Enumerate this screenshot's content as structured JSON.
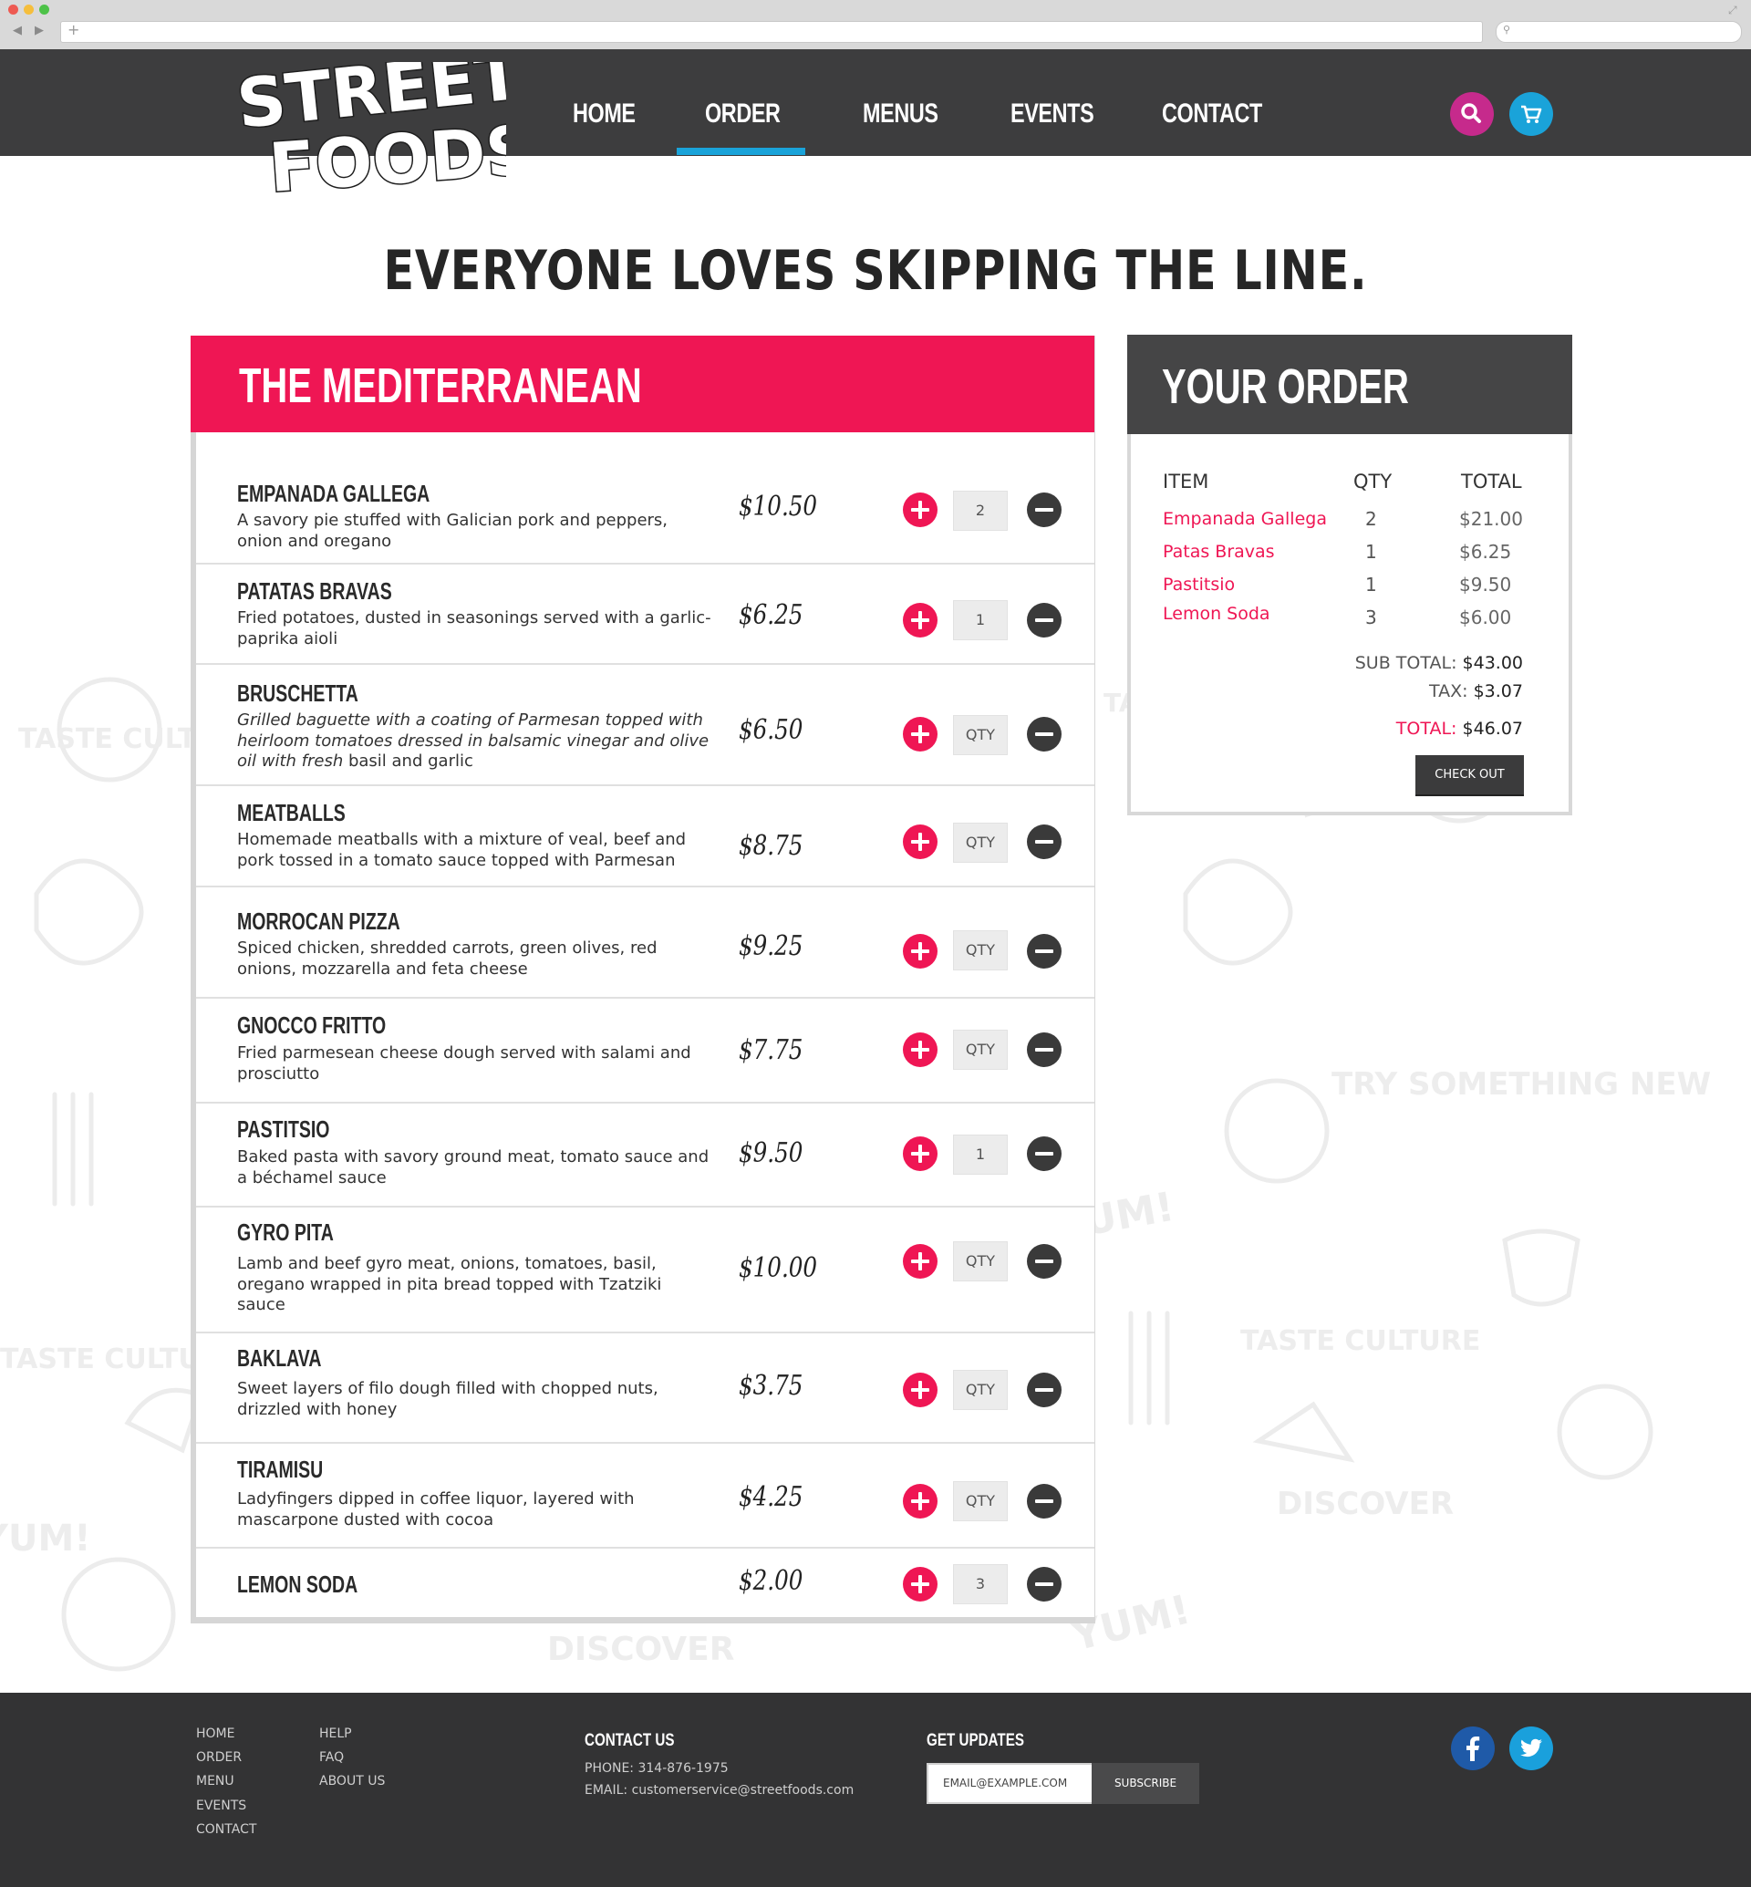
{
  "colors": {
    "header_bg": "#3d3d3e",
    "accent_pink": "#ef1654",
    "accent_blue": "#1aa3d9",
    "search_button": "#c62a8c",
    "cart_button": "#1aa3d9",
    "dark_button": "#3a3a3a",
    "footer_bg": "#333334",
    "facebook": "#1f5aa8",
    "twitter": "#1aa0dc"
  },
  "header": {
    "logo_text": "STREET FOODS",
    "nav": [
      {
        "label": "HOME",
        "active": false
      },
      {
        "label": "ORDER",
        "active": true
      },
      {
        "label": "MENUS",
        "active": false
      },
      {
        "label": "EVENTS",
        "active": false
      },
      {
        "label": "CONTACT",
        "active": false
      }
    ],
    "icons": [
      "search-icon",
      "cart-icon"
    ]
  },
  "tagline": "EVERYONE LOVES SKIPPING THE LINE.",
  "menu": {
    "title": "THE MEDITERRANEAN",
    "items": [
      {
        "name": "EMPANADA GALLEGA",
        "desc": "A savory pie stuffed with Galician pork and peppers, onion and oregano",
        "price": "$10.50",
        "qty": "2"
      },
      {
        "name": "PATATAS BRAVAS",
        "desc": "Fried potatoes, dusted in seasonings served with a garlic-paprika aioli",
        "price": "$6.25",
        "qty": "1"
      },
      {
        "name": "BRUSCHETTA",
        "desc_italic": "Grilled baguette with a coating of Parmesan topped with heirloom tomatoes dressed in balsamic vinegar and olive oil with fresh",
        "desc_rest": " basil and garlic",
        "price": "$6.50",
        "qty_placeholder": "QTY"
      },
      {
        "name": "MEATBALLS",
        "desc": "Homemade meatballs with a mixture of veal, beef and pork tossed in a tomato sauce topped with Parmesan",
        "price": "$8.75",
        "qty_placeholder": "QTY"
      },
      {
        "name": "MORROCAN PIZZA",
        "desc": "Spiced chicken, shredded carrots, green olives, red onions, mozzarella and feta cheese",
        "price": "$9.25",
        "qty_placeholder": "QTY"
      },
      {
        "name": "GNOCCO FRITTO",
        "desc": "Fried parmesean cheese dough served with salami and prosciutto",
        "price": "$7.75",
        "qty_placeholder": "QTY"
      },
      {
        "name": "PASTITSIO",
        "desc": "Baked pasta with savory ground meat, tomato sauce and a béchamel sauce",
        "price": "$9.50",
        "qty": "1"
      },
      {
        "name": "GYRO PITA",
        "desc": "Lamb and beef gyro meat, onions, tomatoes, basil, oregano wrapped in pita bread topped with Tzatziki sauce",
        "price": "$10.00",
        "qty_placeholder": "QTY"
      },
      {
        "name": "BAKLAVA",
        "desc": "Sweet layers of filo dough filled with chopped nuts, drizzled with honey",
        "price": "$3.75",
        "qty_placeholder": "QTY"
      },
      {
        "name": "TIRAMISU",
        "desc": "Ladyfingers dipped in coffee liquor, layered with mascarpone dusted with cocoa",
        "price": "$4.25",
        "qty_placeholder": "QTY"
      },
      {
        "name": "LEMON SODA",
        "price": "$2.00",
        "qty": "3"
      }
    ]
  },
  "order": {
    "title": "YOUR ORDER",
    "headers": {
      "item": "ITEM",
      "qty": "QTY",
      "total": "TOTAL"
    },
    "lines": [
      {
        "item": "Empanada Gallega",
        "qty": "2",
        "total": "$21.00"
      },
      {
        "item": "Patas Bravas",
        "qty": "1",
        "total": "$6.25"
      },
      {
        "item": "Pastitsio",
        "qty": "1",
        "total": "$9.50"
      },
      {
        "item": "Lemon Soda",
        "qty": "3",
        "total": "$6.00"
      }
    ],
    "subtotal_label": "SUB TOTAL:",
    "subtotal": "$43.00",
    "tax_label": "TAX:",
    "tax": "$3.07",
    "total_label": "TOTAL:",
    "total": "$46.07",
    "checkout_label": "CHECK OUT"
  },
  "footer": {
    "links_col1": [
      "HOME",
      "ORDER",
      "MENU",
      "EVENTS",
      "CONTACT"
    ],
    "links_col2": [
      "HELP",
      "FAQ",
      "ABOUT US"
    ],
    "contact_heading": "CONTACT US",
    "phone": "PHONE: 314-876-1975",
    "email": "EMAIL: customerservice@streetfoods.com",
    "updates_heading": "GET UPDATES",
    "email_placeholder": "EMAIL@EXAMPLE.COM",
    "subscribe_label": "SUBSCRIBE",
    "social": [
      "facebook-icon",
      "twitter-icon"
    ]
  }
}
